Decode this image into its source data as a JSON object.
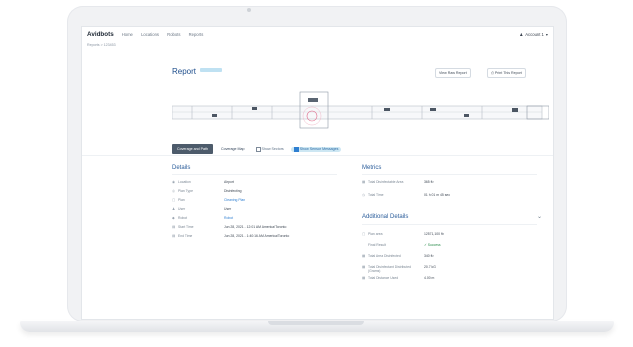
{
  "app": {
    "brand": "Avidbots",
    "nav": [
      "Home",
      "Locations",
      "Robots",
      "Reports"
    ],
    "user": "Account 1"
  },
  "breadcrumb": "Reports > 123453",
  "report": {
    "title": "Report",
    "view_raw_label": "View Raw Report",
    "print_label": "Print This Report"
  },
  "map_tabs": {
    "coverage_path": "Coverage and Path",
    "coverage_map": "Coverage Map",
    "show_sectors": "Show Sectors",
    "show_sensor": "Show Sensor Messages"
  },
  "details": {
    "title": "Details",
    "rows": [
      {
        "label": "Location",
        "value": "Airport",
        "icon": "location-icon",
        "glyph": "◉"
      },
      {
        "label": "Plan Type",
        "value": "Disinfecting",
        "icon": "plan-type-icon",
        "glyph": "◎"
      },
      {
        "label": "Plan",
        "value": "Cleaning Plan",
        "icon": "plan-icon",
        "glyph": "▢"
      },
      {
        "label": "User",
        "value": "User",
        "icon": "user-icon",
        "glyph": "♟"
      },
      {
        "label": "Robot",
        "value": "Robot",
        "icon": "robot-icon",
        "glyph": "◆"
      },
      {
        "label": "Start Time",
        "value": "Jun 28, 2021 - 12:01 AM America/Toronto",
        "icon": "calendar-icon",
        "glyph": "▤"
      },
      {
        "label": "End Time",
        "value": "Jun 28, 2021 - 1:40:16 AM America/Toronto",
        "icon": "calendar-end-icon",
        "glyph": "▤"
      }
    ]
  },
  "metrics": {
    "title": "Metrics",
    "rows": [
      {
        "label": "Total Disinfectable Area",
        "value": "365 ft²",
        "icon": "area-icon",
        "glyph": "▦"
      },
      {
        "label": "Total Time",
        "value": "01 h 01 m 45 sec",
        "icon": "clock-icon",
        "glyph": "◷"
      }
    ]
  },
  "additional": {
    "title": "Additional Details",
    "rows": [
      {
        "label": "Plan area",
        "value": "12571,100 ft²",
        "icon": "plan-area-icon",
        "glyph": "▢"
      },
      {
        "label": "Final Result",
        "value": "✓ Success",
        "icon": "",
        "glyph": ""
      },
      {
        "label": "Total Area Disinfected",
        "value": "340 ft²",
        "icon": "area2-icon",
        "glyph": "▦"
      },
      {
        "label": "Total Disinfectant Distributed (Grams)",
        "value": "20.7 kG",
        "icon": "disinfectant-icon",
        "glyph": "▦"
      },
      {
        "label": "Total Distance Used",
        "value": "4.00 m",
        "icon": "distance-icon",
        "glyph": "▦"
      }
    ]
  },
  "colors": {
    "accent": "#2f7fd1",
    "title": "#1e4e8c",
    "success": "#2a8c4b"
  }
}
